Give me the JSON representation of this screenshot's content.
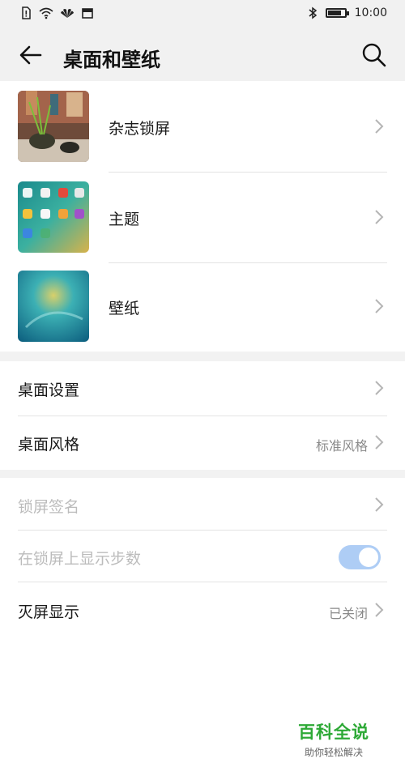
{
  "status_bar": {
    "time": "10:00",
    "battery_level": 0.8,
    "icons": [
      "sim-alert-icon",
      "wifi-icon",
      "huawei-logo-icon",
      "calendar-icon",
      "bluetooth-icon",
      "battery-icon"
    ]
  },
  "header": {
    "title": "桌面和壁纸"
  },
  "image_items": [
    {
      "label": "杂志锁屏"
    },
    {
      "label": "主题"
    },
    {
      "label": "壁纸"
    }
  ],
  "settings_group1": [
    {
      "label": "桌面设置",
      "value": ""
    },
    {
      "label": "桌面风格",
      "value": "标准风格"
    }
  ],
  "settings_group2": [
    {
      "label": "锁屏签名",
      "value": "",
      "disabled": true
    },
    {
      "label": "在锁屏上显示步数",
      "toggle": true,
      "toggle_on": true,
      "disabled": true
    },
    {
      "label": "灭屏显示",
      "value": "已关闭"
    }
  ],
  "watermark": {
    "title": "百科全说",
    "subtitle": "助你轻松解决"
  },
  "colors": {
    "background": "#f2f2f2",
    "card": "#ffffff",
    "toggle_on": "#aecdf5",
    "watermark_green": "#2da936"
  }
}
